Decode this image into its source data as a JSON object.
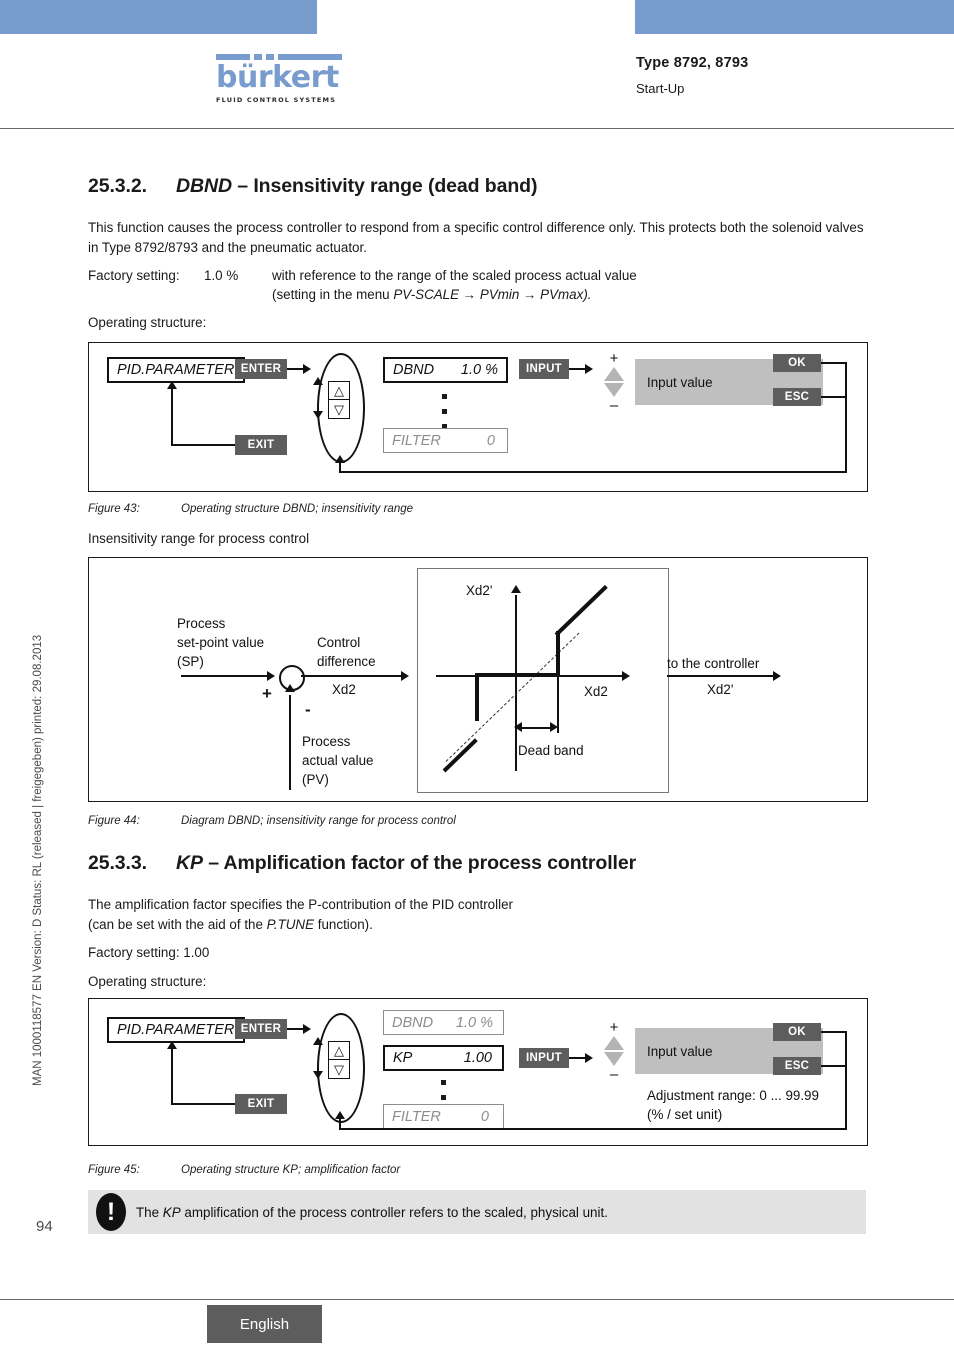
{
  "header": {
    "logo_word": "bürkert",
    "logo_tagline": "FLUID CONTROL SYSTEMS",
    "type_line": "Type 8792, 8793",
    "sub_line": "Start-Up"
  },
  "sidebar": {
    "meta": "MAN 1000118577  EN  Version: D  Status: RL (released | freigegeben)  printed: 29.08.2013",
    "page_number": "94"
  },
  "sections": {
    "s1": {
      "number": "25.3.2.",
      "title_italic": "DBND",
      "title_rest": "– Insensitivity range (dead band)",
      "para1": "This function causes the process controller to respond from a specific control difference only. This protects both the solenoid valves in Type 8792/8793 and the pneumatic actuator.",
      "factory_label": "Factory setting:",
      "factory_value": "1.0 %",
      "factory_note1": "with reference to the range of the scaled process actual value",
      "factory_note2_pre": "(setting in the menu ",
      "factory_note2_italic": "PV-SCALE → PVmin → PVmax).",
      "operating_label": "Operating structure:",
      "subhead": "Insensitivity range for process control"
    },
    "s2": {
      "number": "25.3.3.",
      "title_italic": "KP",
      "title_rest": "– Amplification factor of the process controller",
      "para1": "The amplification factor specifies the P-contribution of the PID controller",
      "para2_pre": "(can be set with the aid of the ",
      "para2_italic": "P.TUNE",
      "para2_post": " function).",
      "factory": "Factory setting: 1.00",
      "operating_label": "Operating structure:"
    }
  },
  "figure43": {
    "caption_label": "Figure 43:",
    "caption_text": "Operating structure DBND; insensitivity range",
    "menu_root": "PID.PARAMETER",
    "enter_button": "ENTER",
    "exit_button": "EXIT",
    "param_active_name": "DBND",
    "param_active_value": "1.0 %",
    "param_last_name": "FILTER",
    "param_last_value": "0",
    "input_button": "INPUT",
    "plus_sign": "+",
    "minus_sign": "–",
    "input_value_label": "Input value",
    "ok_button": "OK",
    "esc_button": "ESC"
  },
  "figure44": {
    "caption_label": "Figure 44:",
    "caption_text": "Diagram DBND; insensitivity range for process control",
    "setpoint_l1": "Process",
    "setpoint_l2": "set-point value",
    "setpoint_l3": "(SP)",
    "control_l1": "Control",
    "control_l2": "difference",
    "control_var": "Xd2",
    "plus_sign": "+",
    "minus_sign": "-",
    "actual_l1": "Process",
    "actual_l2": "actual value",
    "actual_l3": "(PV)",
    "y_axis_label": "Xd2'",
    "x_axis_label": "Xd2",
    "dead_band_label": "Dead band",
    "out_l1": "to the controller",
    "out_var": "Xd2'"
  },
  "figure45": {
    "caption_label": "Figure 45:",
    "caption_text": "Operating structure KP; amplification factor",
    "menu_root": "PID.PARAMETER",
    "enter_button": "ENTER",
    "exit_button": "EXIT",
    "param_first_name": "DBND",
    "param_first_value": "1.0 %",
    "param_active_name": "KP",
    "param_active_value": "1.00",
    "param_last_name": "FILTER",
    "param_last_value": "0",
    "input_button": "INPUT",
    "plus_sign": "+",
    "minus_sign": "–",
    "input_value_label": "Input value",
    "range_l1": "Adjustment range: 0 ... 99.99",
    "range_l2": "(% / set unit)",
    "ok_button": "OK",
    "esc_button": "ESC"
  },
  "note": {
    "icon_glyph": "!",
    "text_pre": "The ",
    "text_italic": "KP",
    "text_post": " amplification of the process controller refers to the scaled, physical unit."
  },
  "footer": {
    "language": "English"
  },
  "colors": {
    "brand_blue": "#789ccd",
    "button_grey": "#5d5d5d",
    "panel_grey": "#bfbfbf",
    "note_grey": "#e2e2e2",
    "dim_grey": "#8d8d8d"
  }
}
